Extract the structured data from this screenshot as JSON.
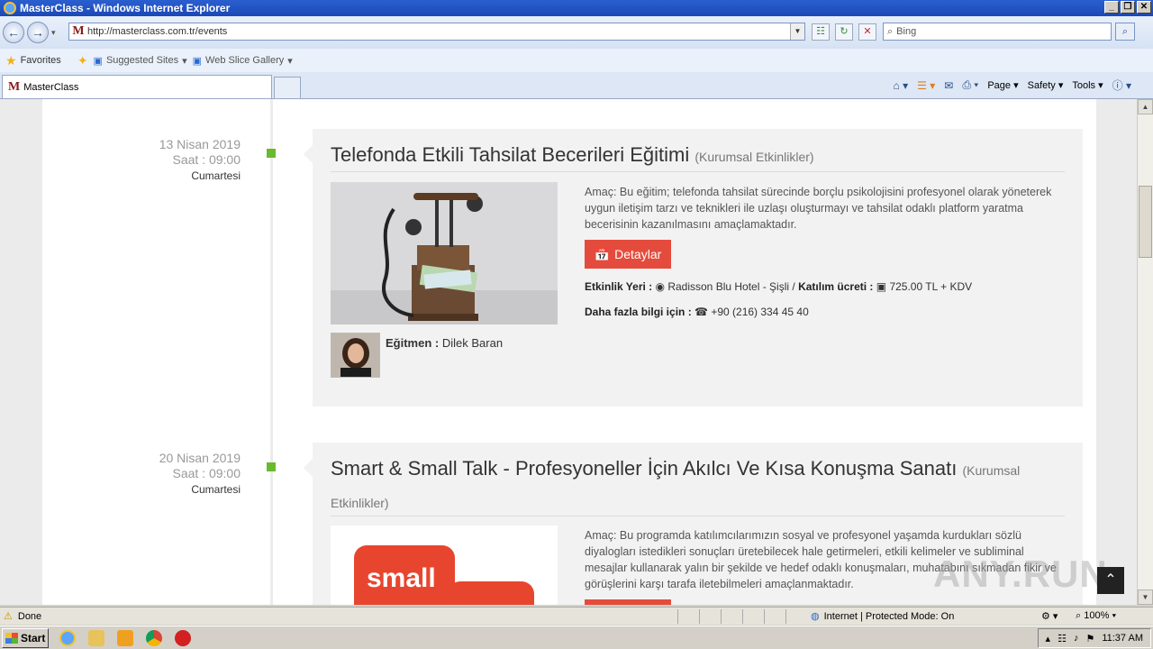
{
  "window": {
    "title": "MasterClass - Windows Internet Explorer",
    "buttons": [
      "_",
      "❐",
      "✕"
    ]
  },
  "addressbar": {
    "url": "http://masterclass.com.tr/events",
    "search_placeholder": "Bing"
  },
  "favorites": {
    "favorites_label": "Favorites",
    "suggested_sites": "Suggested Sites",
    "web_slice_gallery": "Web Slice Gallery"
  },
  "tabs": [
    {
      "label": "MasterClass"
    }
  ],
  "commandbar": {
    "page": "Page",
    "safety": "Safety",
    "tools": "Tools"
  },
  "events": [
    {
      "date": "13 Nisan 2019",
      "time": "Saat : 09:00",
      "day": "Cumartesi",
      "title": "Telefonda Etkili Tahsilat Becerileri Eğitimi",
      "category": "(Kurumsal Etkinlikler)",
      "description": "Amaç: Bu eğitim; telefonda tahsilat sürecinde borçlu psikolojisini profesyonel olarak yöneterek uygun iletişim tarzı ve teknikleri ile uzlaşı oluşturmayı ve tahsilat odaklı platform yaratma becerisinin kazanılmasını amaçlamaktadır.",
      "detail_button": "Detaylar",
      "venue_label": "Etkinlik Yeri :",
      "venue": "Radisson Blu Hotel - Şişli",
      "fee_label": "Katılım ücreti :",
      "fee": "725.00 TL + KDV",
      "info_label": "Daha fazla bilgi için :",
      "phone": "+90 (216) 334 45 40",
      "trainer_label": "Eğitmen :",
      "trainer": "Dilek Baran"
    },
    {
      "date": "20 Nisan 2019",
      "time": "Saat : 09:00",
      "day": "Cumartesi",
      "title": "Smart & Small Talk - Profesyoneller İçin Akılcı Ve Kısa Konuşma Sanatı",
      "category": "(Kurumsal Etkinlikler)",
      "description": "Amaç: Bu programda katılımcılarımızın sosyal ve profesyonel yaşamda kurdukları sözlü diyalogları istedikleri sonuçları üretebilecek hale getirmeleri, etkili kelimeler ve subliminal mesajlar kullanarak yalın bir şekilde ve hedef odaklı konuşmaları, muhatabını sıkmadan fikir ve görüşlerini karşı tarafa iletebilmeleri amaçlanmaktadır.",
      "image_text": "small"
    }
  ],
  "statusbar": {
    "status": "Done",
    "zone": "Internet | Protected Mode: On",
    "zoom": "100%"
  },
  "taskbar": {
    "start": "Start",
    "clock": "11:37 AM"
  },
  "watermark": "ANY.RUN",
  "colors": {
    "accent_red": "#e54b3c",
    "timeline_green": "#6aba2d"
  }
}
